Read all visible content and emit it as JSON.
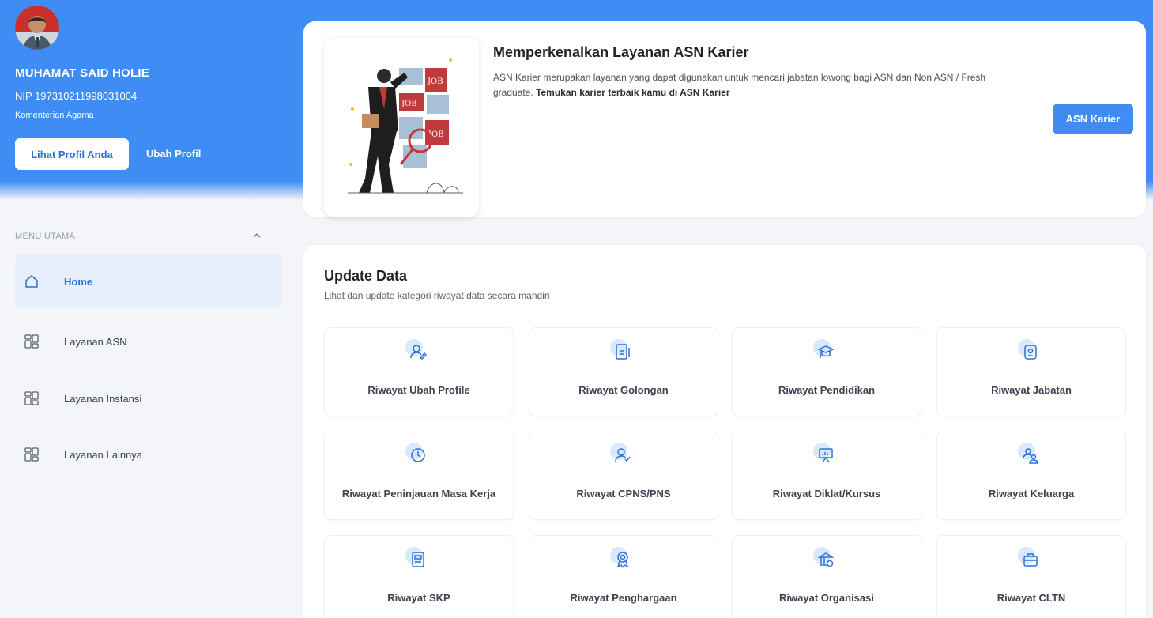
{
  "profile": {
    "name": "MUHAMAT SAID HOLIE",
    "nip": "NIP 197310211998031004",
    "organization": "Komenterian Agama",
    "view_profile_label": "Lihat Profil Anda",
    "edit_profile_label": "Ubah Profil"
  },
  "menu": {
    "heading": "MENU UTAMA",
    "collapse_icon": "chevron-up-icon",
    "items": [
      {
        "label": "Home",
        "icon": "home-icon",
        "active": true
      },
      {
        "label": "Layanan ASN",
        "icon": "grid-icon",
        "active": false
      },
      {
        "label": "Layanan Instansi",
        "icon": "grid-icon",
        "active": false
      },
      {
        "label": "Layanan Lainnya",
        "icon": "grid-icon",
        "active": false
      }
    ]
  },
  "hero": {
    "title": "Memperkenalkan Layanan ASN Karier",
    "description": "ASN Karier merupakan layanan yang dapat digunakan untuk mencari jabatan lowong bagi ASN dan Non ASN / Fresh graduate.",
    "description_bold": "Temukan karier terbaik kamu di ASN Karier",
    "button_label": "ASN Karier",
    "illustration": "job-search-illustration"
  },
  "update": {
    "title": "Update Data",
    "subtitle": "Lihat dan update kategori riwayat data secara mandiri",
    "tiles": [
      {
        "label": "Riwayat Ubah Profile",
        "icon": "user-edit-icon"
      },
      {
        "label": "Riwayat Golongan",
        "icon": "id-card-icon"
      },
      {
        "label": "Riwayat Pendidikan",
        "icon": "graduation-cap-icon"
      },
      {
        "label": "Riwayat Jabatan",
        "icon": "briefcase-id-icon"
      },
      {
        "label": "Riwayat Peninjauan Masa Kerja",
        "icon": "clock-icon"
      },
      {
        "label": "Riwayat CPNS/PNS",
        "icon": "user-check-icon"
      },
      {
        "label": "Riwayat Diklat/Kursus",
        "icon": "presentation-icon"
      },
      {
        "label": "Riwayat Keluarga",
        "icon": "family-icon"
      },
      {
        "label": "Riwayat SKP",
        "icon": "document-icon"
      },
      {
        "label": "Riwayat Penghargaan",
        "icon": "award-icon"
      },
      {
        "label": "Riwayat Organisasi",
        "icon": "organization-icon"
      },
      {
        "label": "Riwayat CLTN",
        "icon": "bag-icon"
      }
    ]
  },
  "colors": {
    "primary": "#3f8cf4",
    "active_menu_bg": "#e6effb",
    "icon_bubble": "#d7e8ff",
    "icon_stroke": "#2f6fd6"
  }
}
